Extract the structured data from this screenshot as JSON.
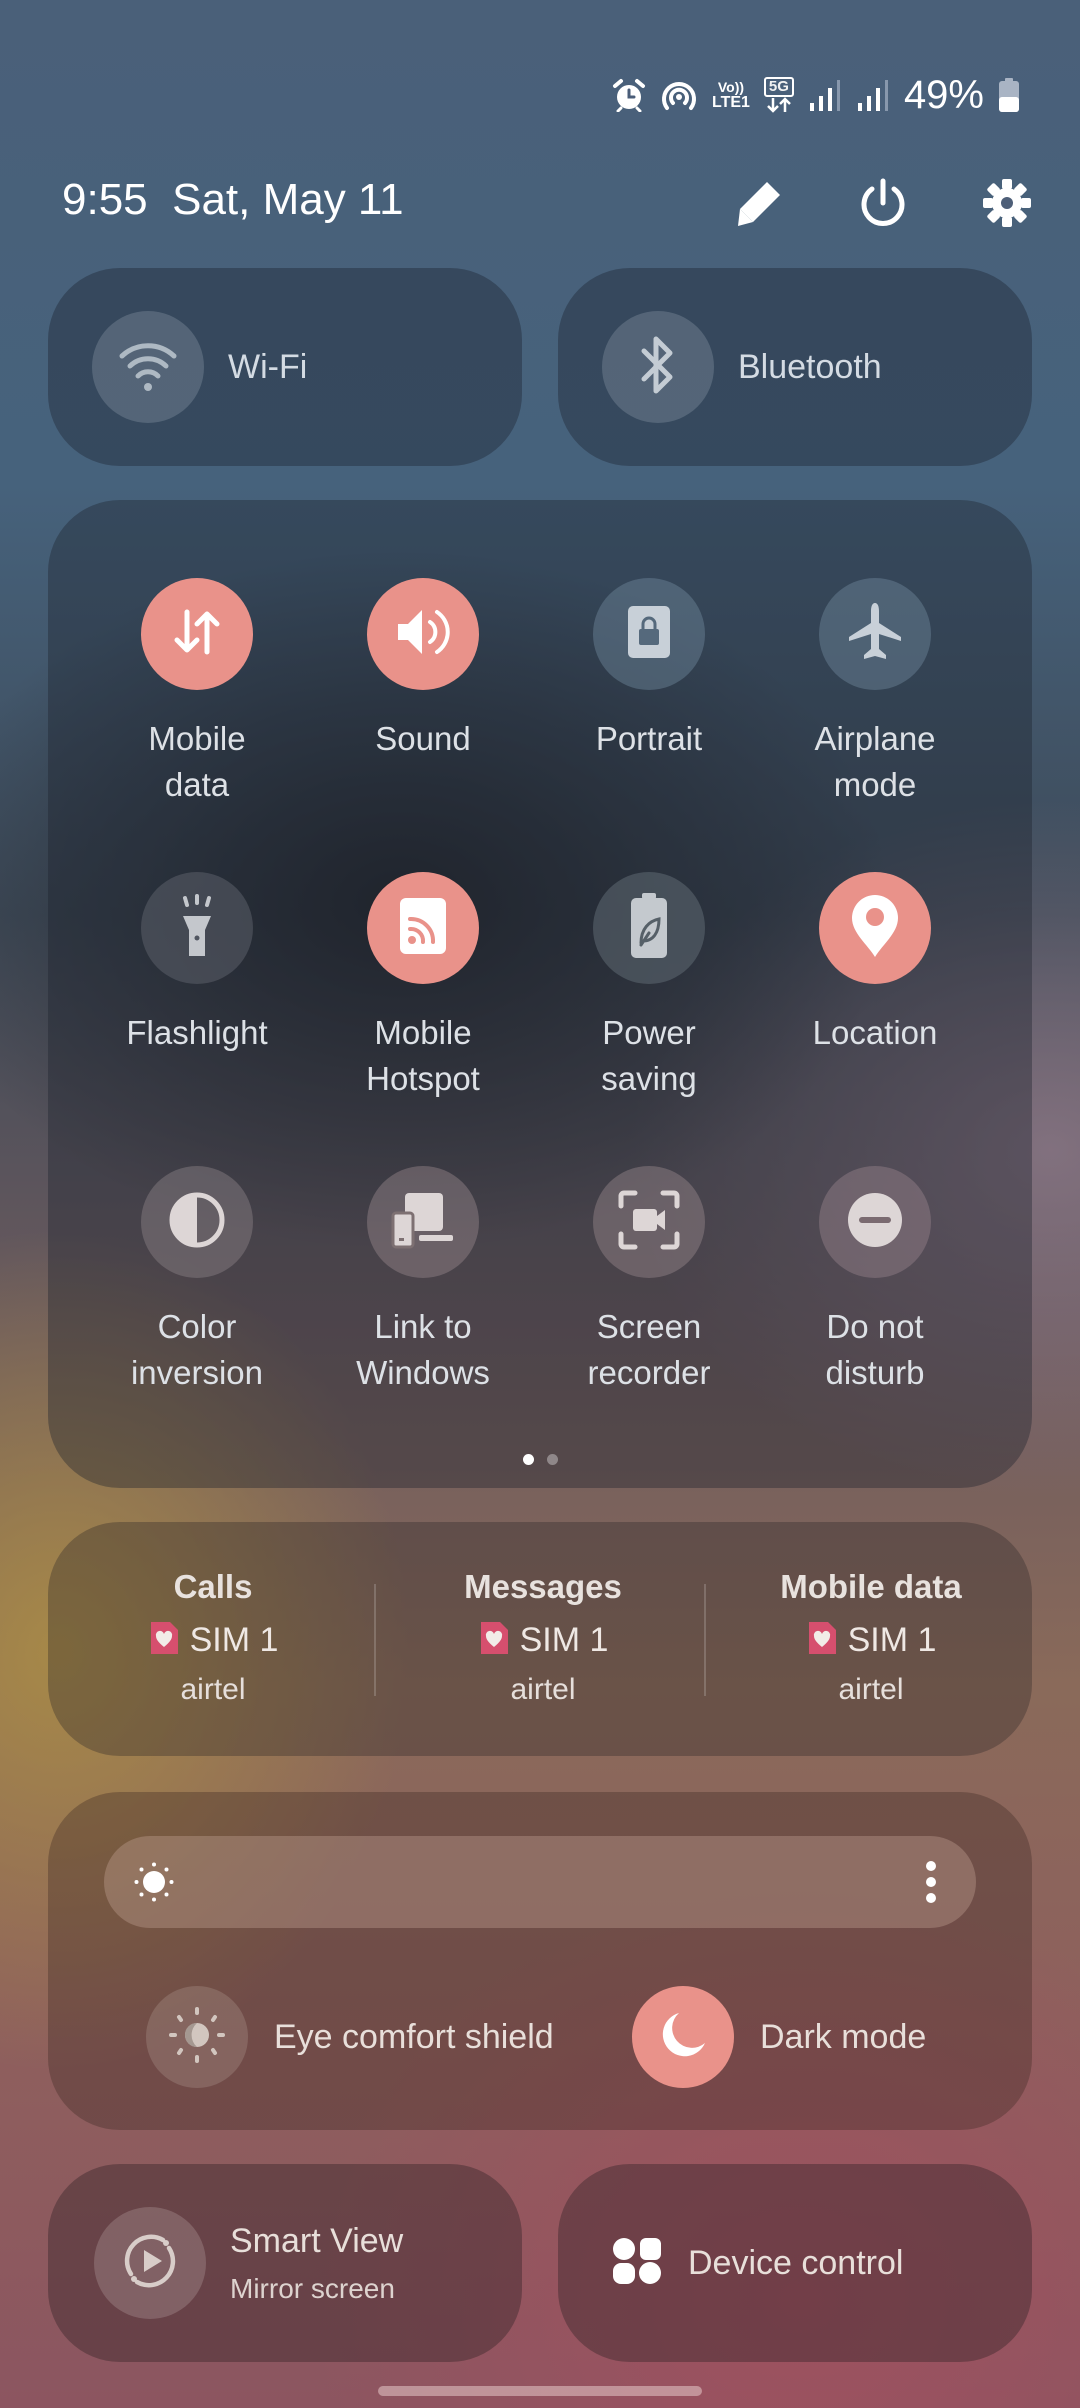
{
  "status_bar": {
    "icons": [
      "alarm-icon",
      "hotspot-broadcast-icon",
      "volte-lte1-icon",
      "5g-data-icon",
      "signal-sim1-icon",
      "signal-sim2-icon",
      "battery-icon"
    ],
    "volte_label_top": "Vo))",
    "volte_label_bottom": "LTE1",
    "network_label": "5G",
    "battery_percent": "49%",
    "battery_level": 0.49
  },
  "header": {
    "time": "9:55",
    "date": "Sat, May 11",
    "actions": [
      {
        "name": "edit",
        "icon": "pencil-icon"
      },
      {
        "name": "power",
        "icon": "power-icon"
      },
      {
        "name": "settings",
        "icon": "gear-icon"
      }
    ]
  },
  "top_tiles": [
    {
      "label": "Wi-Fi",
      "icon": "wifi-icon",
      "state": "off"
    },
    {
      "label": "Bluetooth",
      "icon": "bluetooth-icon",
      "state": "off"
    }
  ],
  "quick_settings": {
    "items": [
      {
        "label": "Mobile\ndata",
        "line1": "Mobile",
        "line2": "data",
        "icon": "mobile-data-icon",
        "on": true
      },
      {
        "label": "Sound",
        "line1": "Sound",
        "line2": "",
        "icon": "sound-icon",
        "on": true
      },
      {
        "label": "Portrait",
        "line1": "Portrait",
        "line2": "",
        "icon": "portrait-lock-icon",
        "on": false
      },
      {
        "label": "Airplane mode",
        "line1": "Airplane",
        "line2": "mode",
        "icon": "airplane-icon",
        "on": false
      },
      {
        "label": "Flashlight",
        "line1": "Flashlight",
        "line2": "",
        "icon": "flashlight-icon",
        "on": false
      },
      {
        "label": "Mobile Hotspot",
        "line1": "Mobile",
        "line2": "Hotspot",
        "icon": "hotspot-icon",
        "on": true
      },
      {
        "label": "Power saving",
        "line1": "Power",
        "line2": "saving",
        "icon": "power-saving-icon",
        "on": false
      },
      {
        "label": "Location",
        "line1": "Location",
        "line2": "",
        "icon": "location-icon",
        "on": true
      },
      {
        "label": "Color inversion",
        "line1": "Color",
        "line2": "inversion",
        "icon": "color-inversion-icon",
        "on": false
      },
      {
        "label": "Link to Windows",
        "line1": "Link to",
        "line2": "Windows",
        "icon": "link-to-windows-icon",
        "on": false
      },
      {
        "label": "Screen recorder",
        "line1": "Screen",
        "line2": "recorder",
        "icon": "screen-recorder-icon",
        "on": false
      },
      {
        "label": "Do not disturb",
        "line1": "Do not",
        "line2": "disturb",
        "icon": "do-not-disturb-icon",
        "on": false
      }
    ],
    "page_current": 1,
    "page_count": 2
  },
  "sim_manager": [
    {
      "title": "Calls",
      "sim": "SIM 1",
      "carrier": "airtel"
    },
    {
      "title": "Messages",
      "sim": "SIM 1",
      "carrier": "airtel"
    },
    {
      "title": "Mobile data",
      "sim": "SIM 1",
      "carrier": "airtel"
    }
  ],
  "brightness": {
    "level": 0.0,
    "more_icon": "more-vertical-icon",
    "toggles": [
      {
        "label": "Eye comfort shield",
        "icon": "eye-comfort-icon",
        "on": false
      },
      {
        "label": "Dark mode",
        "icon": "dark-mode-moon-icon",
        "on": true
      }
    ]
  },
  "bottom_tiles": [
    {
      "label": "Smart View",
      "sublabel": "Mirror screen",
      "icon": "smart-view-icon"
    },
    {
      "label": "Device control",
      "sublabel": "",
      "icon": "device-control-icon"
    }
  ],
  "colors": {
    "accent_on": "#e9928a",
    "sim_badge": "#d64f6e"
  }
}
